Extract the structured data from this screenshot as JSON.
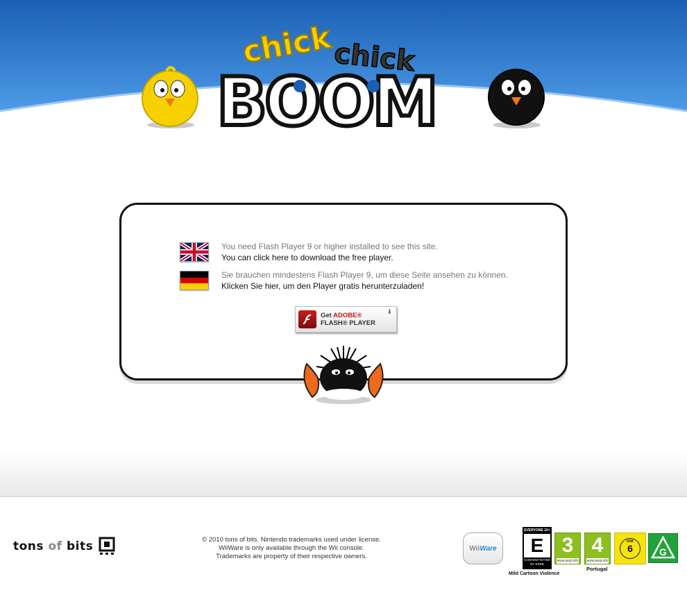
{
  "header": {
    "logo_line1": "chick",
    "logo_line2": "chick",
    "logo_main": "BOOM",
    "colors": {
      "sky_top": "#1a5fb4",
      "sky_bottom": "#4d9be6",
      "logo_yellow": "#f7d000"
    }
  },
  "notice": {
    "english": {
      "flag_icon": "uk-flag-icon",
      "line1": "You need Flash Player 9 or higher installed to see this site.",
      "line2": "You can click here to download the free player."
    },
    "german": {
      "flag_icon": "german-flag-icon",
      "line1": "Sie brauchen mindestens Flash Player 9, um diese Seite ansehen zu können.",
      "line2": "Klicken Sie hier, um den Player gratis herunterzuladen!"
    },
    "flash_button": {
      "get": "Get",
      "adobe": "ADOBE®",
      "product": "FLASH® PLAYER",
      "icon": "flash-player-icon"
    }
  },
  "footer": {
    "publisher_logo": {
      "tons": "tons",
      "of": "of",
      "bits": "bits"
    },
    "copyright_lines": [
      "© 2010 tons of bits. Nintendo trademarks used under license.",
      "WiiWare is only available through the Wii console.",
      "Trademarks are property of their respective owners."
    ],
    "wiiware": {
      "wii": "Wii",
      "ware": "Ware"
    },
    "esrb": {
      "top": "EVERYONE 10+",
      "letter": "E",
      "bottom": "CONTENT RATED BY ESRB",
      "descriptor": "Mild Cartoon Violence"
    },
    "pegi_3": {
      "age": "3",
      "url": "www.pegi.info"
    },
    "pegi_4": {
      "age": "4",
      "url": "www.pegi.info",
      "note": "Portugal"
    },
    "usk": {
      "label": "USK",
      "age": "6"
    },
    "g_rating": {
      "letter": "G"
    }
  }
}
